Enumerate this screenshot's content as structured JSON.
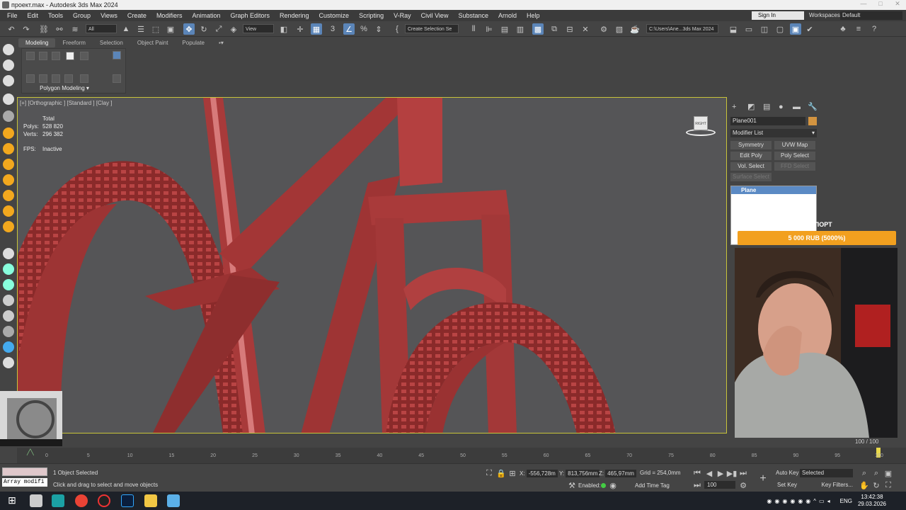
{
  "title": "проект.max - Autodesk 3ds Max 2024",
  "window_controls": [
    "—",
    "□",
    "✕"
  ],
  "menu": [
    "File",
    "Edit",
    "Tools",
    "Group",
    "Views",
    "Create",
    "Modifiers",
    "Animation",
    "Graph Editors",
    "Rendering",
    "Customize",
    "Scripting",
    "V-Ray",
    "Civil View",
    "Substance",
    "Arnold",
    "Help"
  ],
  "signin": "Sign In",
  "workspaces_label": "Workspaces:",
  "workspaces_value": "Default",
  "toolbar": {
    "filter": "All",
    "refcoord": "View",
    "selection_set": "Create Selection Se",
    "path": "C:\\Users\\Ane...3ds Max 2024"
  },
  "ribbon": {
    "tabs": [
      "Modeling",
      "Freeform",
      "Selection",
      "Object Paint",
      "Populate"
    ],
    "label": "Polygon Modeling"
  },
  "viewport": {
    "label": "[+] [Orthographic ] [Standard ] [Clay ]",
    "stats_header": "Total",
    "polys_label": "Polys:",
    "polys_value": "528 820",
    "verts_label": "Verts:",
    "verts_value": "296 382",
    "fps_label": "FPS:",
    "fps_value": "Inactive",
    "viewcube_label": "RIGHT"
  },
  "command_panel": {
    "object_name": "Plane001",
    "object_color": "#d39440",
    "modifier_list": "Modifier List",
    "buttons": [
      "Symmetry",
      "UVW Map",
      "Edit Poly",
      "Poly Select",
      "Vol. Select",
      "FFD Select",
      "Surface Select"
    ],
    "stack_item": "Plane"
  },
  "donation": {
    "title": "СУППОРТ",
    "amount": "5 000 RUB (5000%)",
    "min": "0",
    "max": "100"
  },
  "timeline": {
    "frames": "100 / 100",
    "ticks": [
      "0",
      "5",
      "10",
      "15",
      "20",
      "25",
      "30",
      "35",
      "40",
      "45",
      "50",
      "55",
      "60",
      "65",
      "70",
      "75",
      "80",
      "85",
      "90",
      "95",
      "100"
    ]
  },
  "status": {
    "maxscript": "Array modifi",
    "selected": "1 Object Selected",
    "hint": "Click and drag to select and move objects",
    "x_label": "X:",
    "x_value": "-556,728m",
    "y_label": "Y:",
    "y_value": "813,756mm",
    "z_label": "Z:",
    "z_value": "465,97mm",
    "grid": "Grid = 254,0mm",
    "enabled": "Enabled:",
    "add_time_tag": "Add Time Tag",
    "autokey": "Auto Key",
    "setkey": "Set Key",
    "selected_dropdown": "Selected",
    "key_filters": "Key Filters...",
    "frame_field": "100"
  },
  "taskbar": {
    "lang": "ENG",
    "time": "13:42:38",
    "date": "29.03.2026"
  }
}
